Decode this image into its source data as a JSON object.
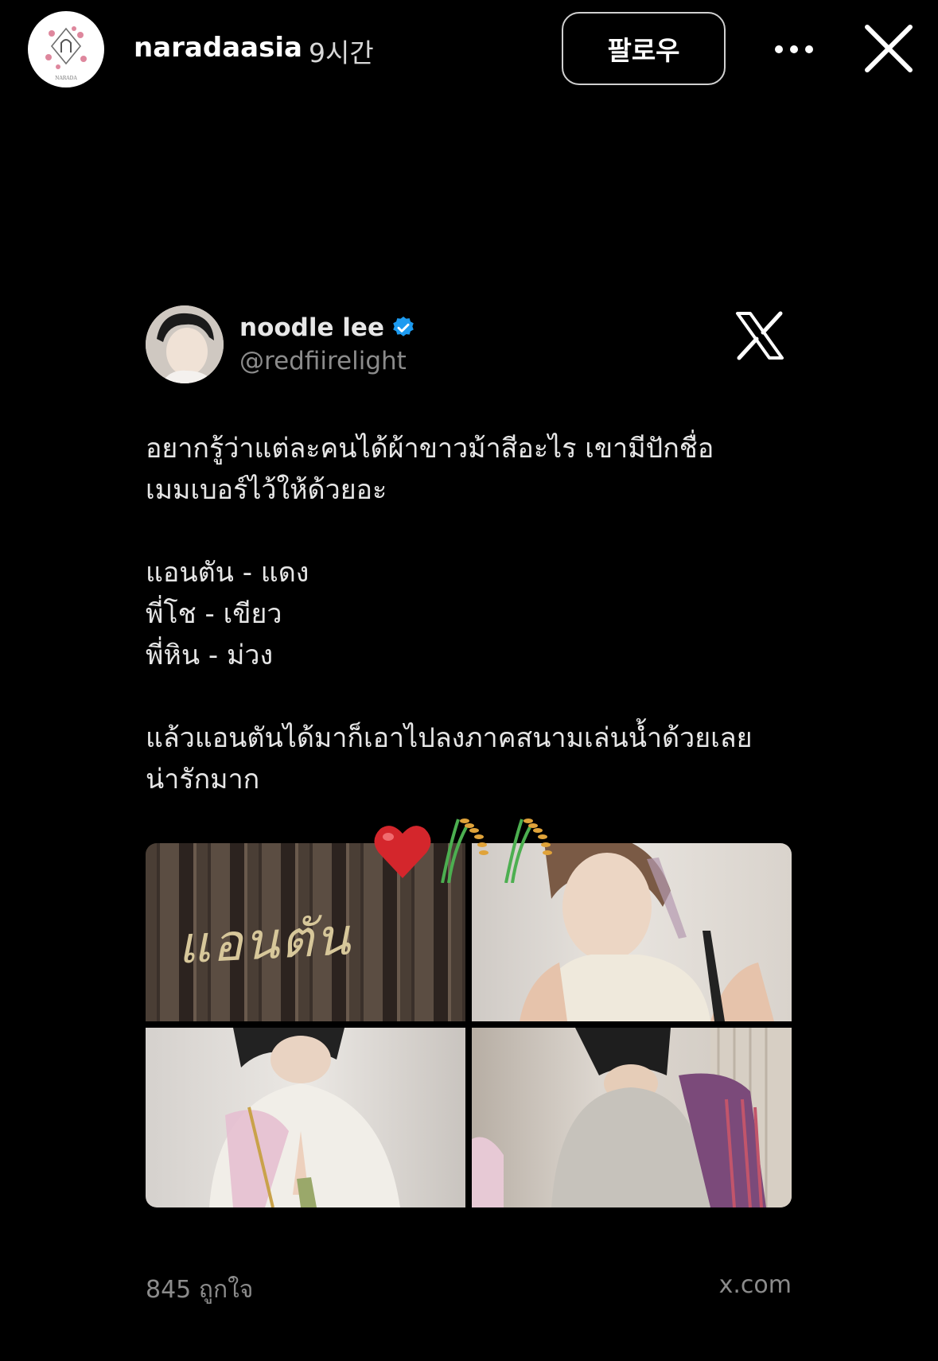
{
  "story_header": {
    "username": "naradaasia",
    "time_ago": "9시간",
    "follow_label": "팔로우",
    "avatar_icon": "narada-logo-icon",
    "more_icon": "more-horizontal-icon",
    "close_icon": "close-icon"
  },
  "tweet": {
    "author_name": "noodle lee",
    "handle": "@redfiirelight",
    "verified_icon": "verified-badge-icon",
    "platform_icon": "x-logo-icon",
    "text_lines": [
      "อยากรู้ว่าแต่ละคนได้ผ้าขาวม้าสีอะไร เขามีปักชื่อ",
      "เมมเบอร์ไว้ให้ด้วยอะ",
      "แอนตัน - แดง",
      "พี่โช - เขียว",
      "พี่หิน - ม่วง",
      "แล้วแอนตันได้มาก็เอาไปลงภาคสนามเล่นน้ำด้วยเลย",
      "น่ารักมาก"
    ],
    "emoji": "❤️🌾🌾",
    "images": [
      {
        "name": "embroidered-cloth-photo",
        "caption": "แอนตัน"
      },
      {
        "name": "person-sleeveless-photo"
      },
      {
        "name": "person-wai-photo"
      },
      {
        "name": "person-with-scarf-photo"
      }
    ],
    "likes": "845 ถูกใจ",
    "source": "x.com"
  },
  "colors": {
    "background": "#000000",
    "text_primary": "#e6e6e6",
    "text_secondary": "#8b8b8b",
    "verified_blue": "#1d9bf0"
  }
}
